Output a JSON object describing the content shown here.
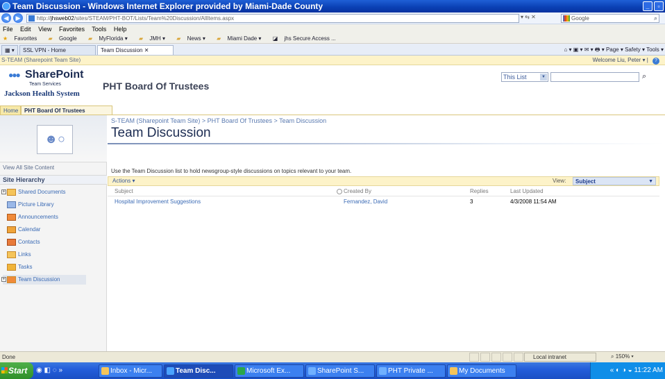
{
  "window": {
    "title": "Team Discussion - Windows Internet Explorer provided by Miami-Dade County",
    "min": "_",
    "restore": "▫"
  },
  "address": {
    "prefix": "http://",
    "host": "jhsweb02",
    "path": "/sites/STEAM/PHT-BOT/Lists/Team%20Discussion/AllItems.aspx",
    "search_placeholder": "Google"
  },
  "menu": [
    "File",
    "Edit",
    "View",
    "Favorites",
    "Tools",
    "Help"
  ],
  "favorites": {
    "label": "Favorites",
    "items": [
      "Google",
      "MyFlorida ▾",
      "JMH ▾",
      "News ▾",
      "Miami Dade ▾",
      "jhs Secure Access ..."
    ]
  },
  "tabs": {
    "items": [
      "SSL VPN - Home",
      "Team Discussion"
    ],
    "tools": "Page ▾  Safety ▾  Tools ▾"
  },
  "sp": {
    "site_link": "S-TEAM (Sharepoint Team Site)",
    "welcome": "Welcome Liu, Peter ▾",
    "logo_name": "SharePoint",
    "logo_sub": "Team Services",
    "org": "Jackson Health System",
    "site_title": "PHT Board Of Trustees",
    "scope": "This List",
    "nav": [
      "Home",
      "PHT Board Of Trustees"
    ]
  },
  "left": {
    "view_all": "View All Site Content",
    "hierarchy": "Site Hierarchy",
    "items": [
      "Shared Documents",
      "Picture Library",
      "Announcements",
      "Calendar",
      "Contacts",
      "Links",
      "Tasks",
      "Team Discussion"
    ]
  },
  "main": {
    "breadcrumb": "S-TEAM (Sharepoint Team Site) > PHT Board Of Trustees > Team Discussion",
    "title": "Team Discussion",
    "description": "Use the Team Discussion list to hold newsgroup-style discussions on topics relevant to your team.",
    "actions": "Actions ▾",
    "view_label": "View:",
    "view_value": "Subject",
    "columns": [
      "Subject",
      "Created By",
      "Replies",
      "Last Updated"
    ],
    "rows": [
      {
        "subject": "Hospital Improvement Suggestions",
        "created_by": "Fernandez, David",
        "replies": "3",
        "updated": "4/3/2008 11:54 AM"
      }
    ]
  },
  "status": {
    "text": "Done",
    "zone": "Local intranet",
    "zoom": "150% ▾"
  },
  "taskbar": {
    "start": "Start",
    "buttons": [
      "Inbox - Micr...",
      "Team Disc...",
      "Microsoft Ex...",
      "SharePoint S...",
      "PHT Private ...",
      "My Documents"
    ],
    "clock": "11:22 AM"
  }
}
